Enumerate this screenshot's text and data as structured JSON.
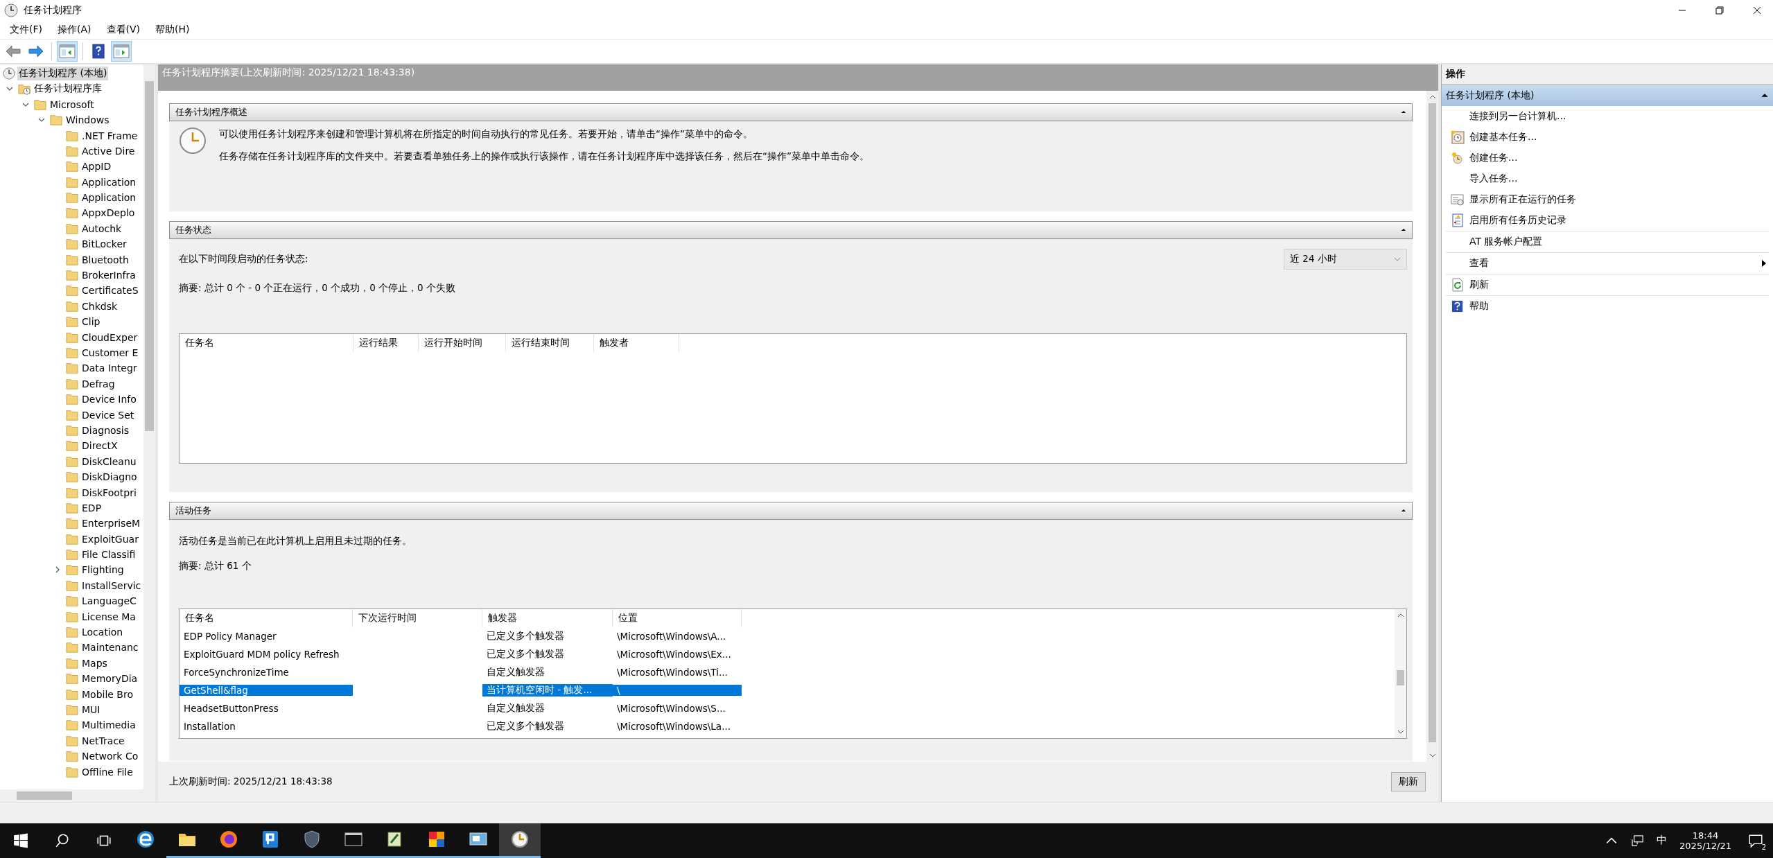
{
  "window": {
    "title": "任务计划程序"
  },
  "menu": [
    "文件(F)",
    "操作(A)",
    "查看(V)",
    "帮助(H)"
  ],
  "toolbar": [
    {
      "kind": "back",
      "disabled": true
    },
    {
      "kind": "forward",
      "disabled": false
    },
    {
      "kind": "tree-toggle",
      "pressed": true
    },
    {
      "kind": "help",
      "pressed": false
    },
    {
      "kind": "pane-toggle",
      "pressed": true
    }
  ],
  "tree": [
    {
      "label": "任务计划程序 (本地)",
      "kind": "scheduler",
      "selected": true,
      "children": [
        {
          "label": "任务计划程序库",
          "kind": "library",
          "selected": false,
          "expanded": true,
          "children": [
            {
              "label": "Microsoft",
              "kind": "folder",
              "selected": false,
              "expanded": true,
              "children": [
                {
                  "label": "Windows",
                  "kind": "folder",
                  "selected": false,
                  "expanded": true,
                  "children": [
                    {
                      "label": ".NET Frame",
                      "kind": "folder",
                      "selected": false
                    },
                    {
                      "label": "Active Dire",
                      "kind": "folder",
                      "selected": false
                    },
                    {
                      "label": "AppID",
                      "kind": "folder",
                      "selected": false
                    },
                    {
                      "label": "Application",
                      "kind": "folder",
                      "selected": false
                    },
                    {
                      "label": "Application",
                      "kind": "folder",
                      "selected": false
                    },
                    {
                      "label": "AppxDeplo",
                      "kind": "folder",
                      "selected": false
                    },
                    {
                      "label": "Autochk",
                      "kind": "folder",
                      "selected": false
                    },
                    {
                      "label": "BitLocker",
                      "kind": "folder",
                      "selected": false
                    },
                    {
                      "label": "Bluetooth",
                      "kind": "folder",
                      "selected": false
                    },
                    {
                      "label": "BrokerInfra",
                      "kind": "folder",
                      "selected": false
                    },
                    {
                      "label": "CertificateS",
                      "kind": "folder",
                      "selected": false
                    },
                    {
                      "label": "Chkdsk",
                      "kind": "folder",
                      "selected": false
                    },
                    {
                      "label": "Clip",
                      "kind": "folder",
                      "selected": false
                    },
                    {
                      "label": "CloudExper",
                      "kind": "folder",
                      "selected": false
                    },
                    {
                      "label": "Customer E",
                      "kind": "folder",
                      "selected": false
                    },
                    {
                      "label": "Data Integr",
                      "kind": "folder",
                      "selected": false
                    },
                    {
                      "label": "Defrag",
                      "kind": "folder",
                      "selected": false
                    },
                    {
                      "label": "Device Info",
                      "kind": "folder",
                      "selected": false
                    },
                    {
                      "label": "Device Set",
                      "kind": "folder",
                      "selected": false
                    },
                    {
                      "label": "Diagnosis",
                      "kind": "folder",
                      "selected": false
                    },
                    {
                      "label": "DirectX",
                      "kind": "folder",
                      "selected": false
                    },
                    {
                      "label": "DiskCleanu",
                      "kind": "folder",
                      "selected": false
                    },
                    {
                      "label": "DiskDiagno",
                      "kind": "folder",
                      "selected": false
                    },
                    {
                      "label": "DiskFootpri",
                      "kind": "folder",
                      "selected": false
                    },
                    {
                      "label": "EDP",
                      "kind": "folder",
                      "selected": false
                    },
                    {
                      "label": "EnterpriseM",
                      "kind": "folder",
                      "selected": false
                    },
                    {
                      "label": "ExploitGuar",
                      "kind": "folder",
                      "selected": false
                    },
                    {
                      "label": "File Classifi",
                      "kind": "folder",
                      "selected": false
                    },
                    {
                      "label": "Flighting",
                      "kind": "folder",
                      "selected": false,
                      "expanded": false
                    },
                    {
                      "label": "InstallServic",
                      "kind": "folder",
                      "selected": false
                    },
                    {
                      "label": "LanguageC",
                      "kind": "folder",
                      "selected": false
                    },
                    {
                      "label": "License Ma",
                      "kind": "folder",
                      "selected": false
                    },
                    {
                      "label": "Location",
                      "kind": "folder",
                      "selected": false
                    },
                    {
                      "label": "Maintenanc",
                      "kind": "folder",
                      "selected": false
                    },
                    {
                      "label": "Maps",
                      "kind": "folder",
                      "selected": false
                    },
                    {
                      "label": "MemoryDia",
                      "kind": "folder",
                      "selected": false
                    },
                    {
                      "label": "Mobile Bro",
                      "kind": "folder",
                      "selected": false
                    },
                    {
                      "label": "MUI",
                      "kind": "folder",
                      "selected": false
                    },
                    {
                      "label": "Multimedia",
                      "kind": "folder",
                      "selected": false
                    },
                    {
                      "label": "NetTrace",
                      "kind": "folder",
                      "selected": false
                    },
                    {
                      "label": "Network Co",
                      "kind": "folder",
                      "selected": false
                    },
                    {
                      "label": "Offline File",
                      "kind": "folder",
                      "selected": false
                    }
                  ]
                }
              ]
            }
          ]
        }
      ]
    }
  ],
  "summary_title": "任务计划程序摘要(上次刷新时间: 2025/12/21 18:43:38)",
  "overview": {
    "title": "任务计划程序概述",
    "expanded": true,
    "paragraphs": [
      "可以使用任务计划程序来创建和管理计算机将在所指定的时间自动执行的常见任务。若要开始，请单击“操作”菜单中的命令。",
      "任务存储在任务计划程序库的文件夹中。若要查看单独任务上的操作或执行该操作，请在任务计划程序库中选择该任务，然后在“操作”菜单中单击命令。"
    ]
  },
  "task_status": {
    "title": "任务状态",
    "expanded": true,
    "period_label": "在以下时间段启动的任务状态:",
    "period": "近 24 小时",
    "summary": "摘要: 总计 0 个 - 0 个正在运行，0 个成功，0 个停止，0 个失败",
    "columns": [
      "任务名",
      "运行结果",
      "运行开始时间",
      "运行结束时间",
      "触发者"
    ]
  },
  "active_tasks": {
    "title": "活动任务",
    "expanded": true,
    "description": "活动任务是当前已在此计算机上启用且未过期的任务。",
    "summary": "摘要: 总计 61 个",
    "columns": [
      "任务名",
      "下次运行时间",
      "触发器",
      "位置"
    ],
    "rows": [
      {
        "task_name": "EDP Policy Manager",
        "trigger": "已定义多个触发器",
        "location": "\\Microsoft\\Windows\\A...",
        "selected": false
      },
      {
        "task_name": "ExploitGuard MDM policy Refresh",
        "trigger": "已定义多个触发器",
        "location": "\\Microsoft\\Windows\\Ex...",
        "selected": false
      },
      {
        "task_name": "ForceSynchronizeTime",
        "trigger": "自定义触发器",
        "location": "\\Microsoft\\Windows\\Ti...",
        "selected": false
      },
      {
        "task_name": "GetShell&flag",
        "trigger": "当计算机空闲时 - 触发...",
        "location": "\\",
        "selected": true
      },
      {
        "task_name": "HeadsetButtonPress",
        "trigger": "自定义触发器",
        "location": "\\Microsoft\\Windows\\S...",
        "selected": false
      },
      {
        "task_name": "Installation",
        "trigger": "已定义多个触发器",
        "location": "\\Microsoft\\Windows\\La...",
        "selected": false
      }
    ]
  },
  "last_refresh": "上次刷新时间: 2025/12/21 18:43:38",
  "refresh_button": "刷新",
  "actions": {
    "title": "操作",
    "group": "任务计划程序 (本地)",
    "expanded": true,
    "groups": [
      [
        {
          "label": "连接到另一台计算机..."
        },
        {
          "label": "创建基本任务..."
        },
        {
          "label": "创建任务..."
        },
        {
          "label": "导入任务..."
        },
        {
          "label": "显示所有正在运行的任务"
        },
        {
          "label": "启用所有任务历史记录"
        }
      ],
      [
        {
          "label": "AT 服务帐户配置"
        }
      ],
      [
        {
          "label": "查看",
          "submenu": true
        }
      ],
      [
        {
          "label": "刷新"
        }
      ],
      [
        {
          "label": "帮助"
        }
      ]
    ]
  },
  "taskbar": {
    "apps": [
      {
        "kind": "edge",
        "running": false,
        "active": false
      },
      {
        "kind": "explorer",
        "running": true,
        "active": false
      },
      {
        "kind": "firefox",
        "running": true,
        "active": false
      },
      {
        "kind": "p-app",
        "running": true,
        "active": false
      },
      {
        "kind": "shield",
        "running": true,
        "active": false
      },
      {
        "kind": "terminal",
        "running": true,
        "active": false
      },
      {
        "kind": "notepad",
        "running": true,
        "active": false
      },
      {
        "kind": "color-app",
        "running": true,
        "active": false
      },
      {
        "kind": "remote",
        "running": true,
        "active": false
      },
      {
        "kind": "scheduler",
        "running": true,
        "active": true
      }
    ],
    "input_method": "中",
    "time": "18:44",
    "date": "2025/12/21",
    "notifications": "2"
  }
}
